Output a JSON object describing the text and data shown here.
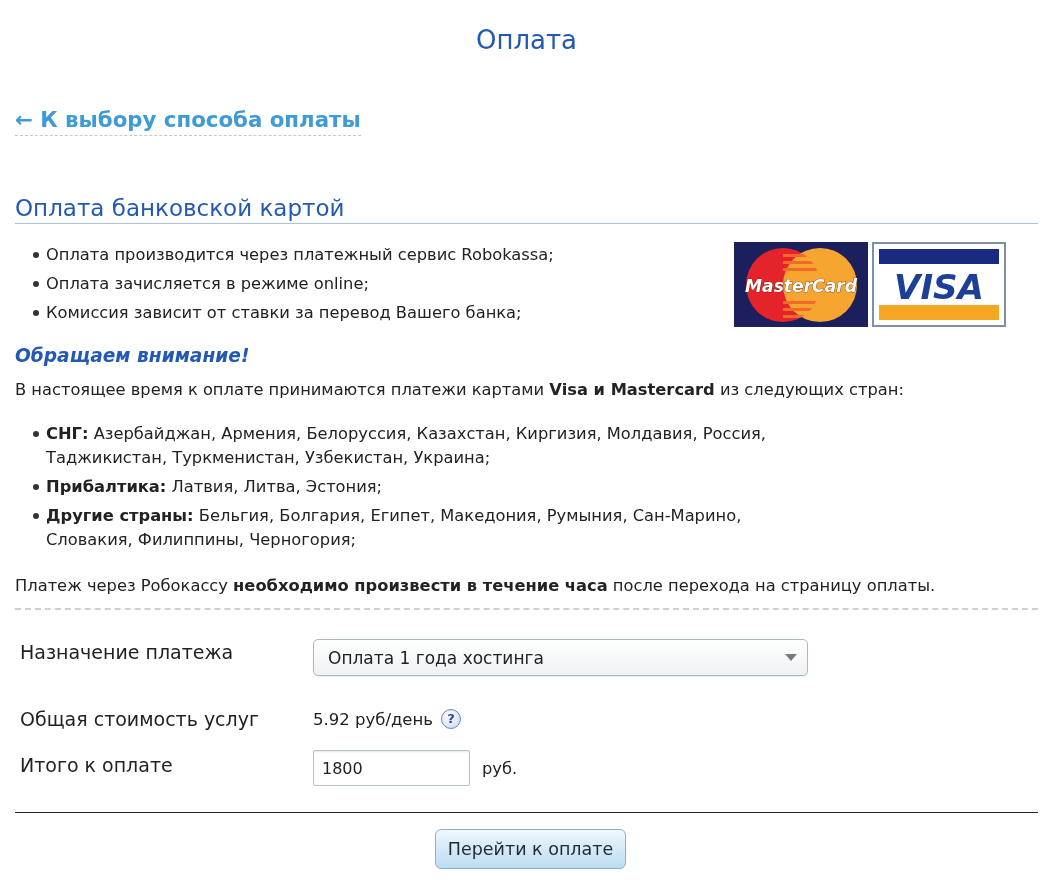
{
  "page_title": "Оплата",
  "back_link": "← К выбору способа оплаты",
  "section": {
    "heading": "Оплата банковской картой",
    "features": [
      "Оплата производится через платежный сервис Robokassa;",
      "Оплата зачисляется в режиме online;",
      "Комиссия зависит от ставки за перевод Вашего банка;"
    ],
    "logos": [
      {
        "kind": "mastercard",
        "text": "MasterCard"
      },
      {
        "kind": "visa",
        "text": "VISA"
      }
    ],
    "notice_heading": "Обращаем внимание!",
    "notice_text": "В настоящее время к оплате принимаются платежи картами **Visa и Mastercard** из следующих стран:",
    "countries": [
      "**СНГ:** Азербайджан, Армения, Белоруссия, Казахстан, Киргизия, Молдавия, Россия, Таджикистан, Туркменистан, Узбекистан, Украина;",
      "**Прибалтика:** Латвия, Литва, Эстония;",
      "**Другие страны:** Бельгия, Болгария, Египет, Македония, Румыния, Сан-Марино, Словакия, Филиппины, Черногория;"
    ],
    "deadline_text": "Платеж через Робокассу **необходимо произвести в течение часа** после перехода на страницу оплаты."
  },
  "form": {
    "purpose": {
      "label": "Назначение платежа",
      "value": "Оплата 1 года хостинга"
    },
    "cost": {
      "label": "Общая стоимость услуг",
      "value": "5.92 руб/день",
      "help": "?"
    },
    "total": {
      "label": "Итого к оплате",
      "value": "1800",
      "unit": "руб."
    },
    "submit": "Перейти к оплате"
  }
}
